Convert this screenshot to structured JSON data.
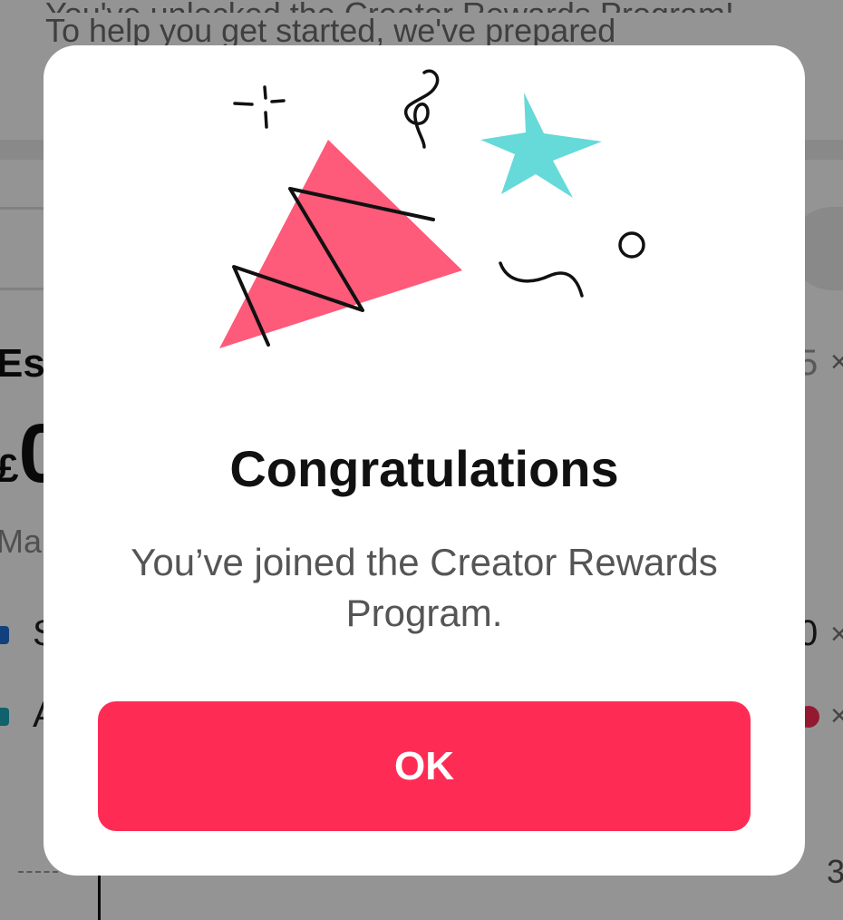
{
  "background": {
    "intro_line_1": "You've unlocked the Creator Rewards Program!",
    "intro_line_2": "To help you get started, we've prepared",
    "estimated_label": "Est",
    "currency_symbol": "£",
    "amount": "0",
    "month_label": "Ma",
    "row_1_label": "S",
    "row_2_label": "A",
    "row_1_value": "0",
    "row_1_value_prefix": "5",
    "close_glyph": "×",
    "axis_value": "3"
  },
  "dialog": {
    "title": "Congratulations",
    "message": "You’ve joined the Creator Rewards Program.",
    "ok_label": "OK",
    "illustration": "party-confetti-illustration"
  },
  "colors": {
    "accent": "#fe2c55",
    "star": "#66d9d9",
    "party_hat": "#fe5a7a",
    "overlay": "rgba(0,0,0,0.42)",
    "row_1_dot": "#1f6fd6",
    "row_2_dot": "#1aa7b8"
  }
}
